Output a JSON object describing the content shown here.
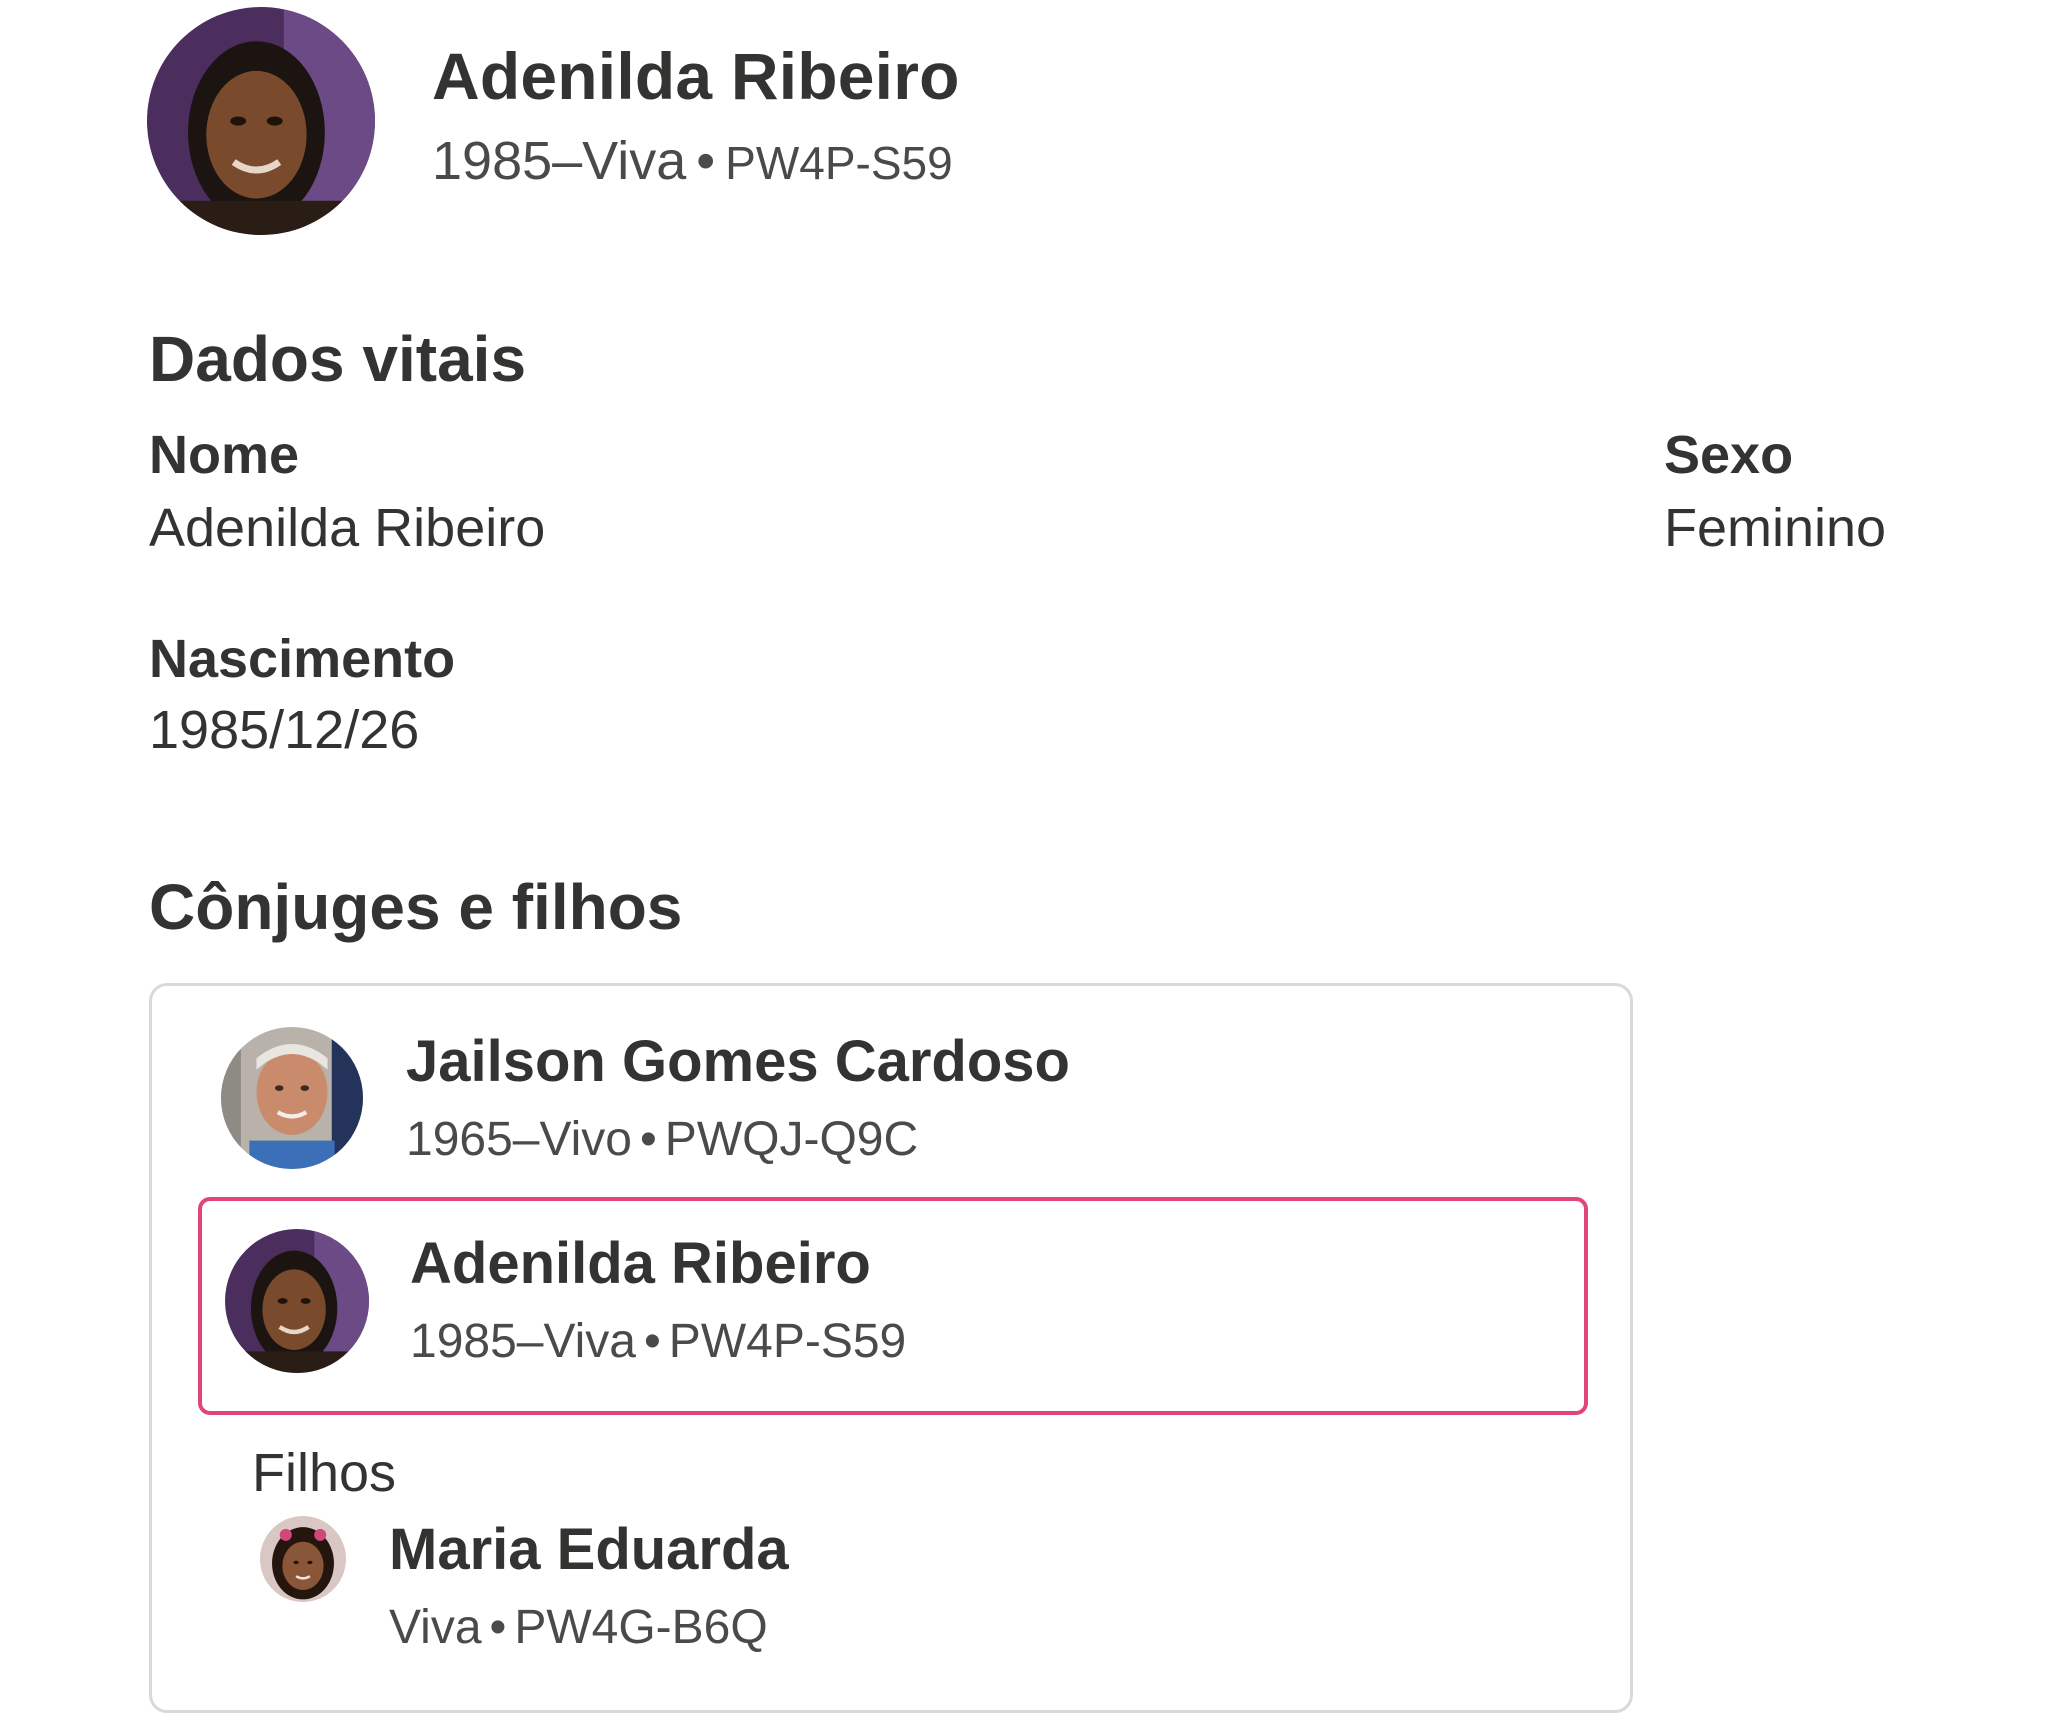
{
  "header": {
    "name": "Adenilda Ribeiro",
    "lifespan": "1985–Viva",
    "separator": "•",
    "pid": "PW4P-S59"
  },
  "vitals": {
    "title": "Dados vitais",
    "name_label": "Nome",
    "name_value": "Adenilda Ribeiro",
    "sex_label": "Sexo",
    "sex_value": "Feminino",
    "birth_label": "Nascimento",
    "birth_value": "1985/12/26"
  },
  "family": {
    "title": "Cônjuges e filhos",
    "spouse": {
      "name": "Jailson Gomes Cardoso",
      "lifespan": "1965–Vivo",
      "separator": "•",
      "pid": "PWQJ-Q9C"
    },
    "self": {
      "name": "Adenilda Ribeiro",
      "lifespan": "1985–Viva",
      "separator": "•",
      "pid": "PW4P-S59"
    },
    "children_label": "Filhos",
    "children": [
      {
        "name": "Maria Eduarda",
        "lifespan": "Viva",
        "separator": "•",
        "pid": "PW4G-B6Q"
      }
    ]
  },
  "colors": {
    "text": "#333331",
    "selected_border": "#e0457b",
    "card_border": "#d9d9d9"
  }
}
